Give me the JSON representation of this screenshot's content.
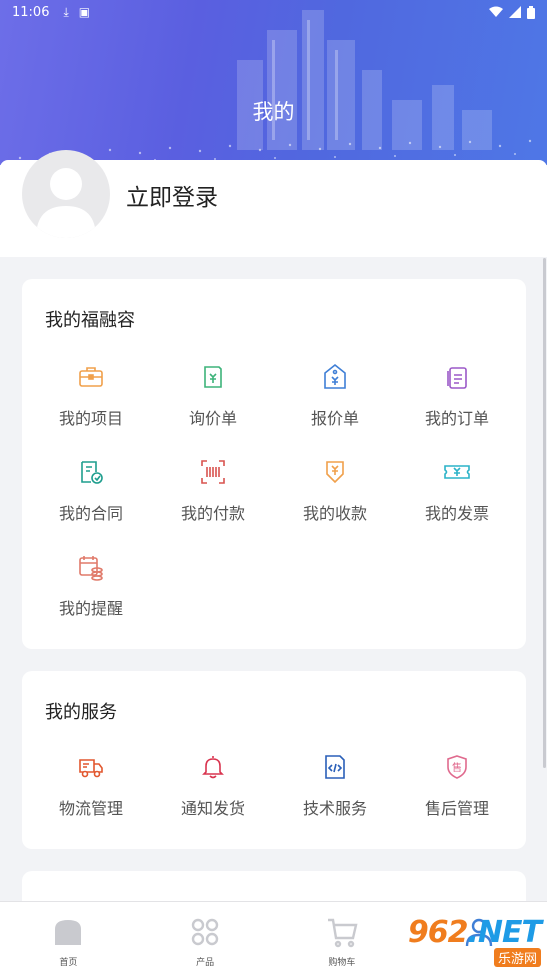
{
  "status_bar": {
    "time": "11:06"
  },
  "header": {
    "title": "我的"
  },
  "profile": {
    "login_label": "立即登录"
  },
  "section_fuzhurong": {
    "title": "我的福融容",
    "items": [
      {
        "label": "我的项目",
        "icon": "briefcase-icon",
        "color": "#f0a04b"
      },
      {
        "label": "询价单",
        "icon": "inquiry-doc-icon",
        "color": "#3db37a"
      },
      {
        "label": "报价单",
        "icon": "price-tag-icon",
        "color": "#3f7fd6"
      },
      {
        "label": "我的订单",
        "icon": "order-doc-icon",
        "color": "#9b59c8"
      },
      {
        "label": "我的合同",
        "icon": "contract-icon",
        "color": "#1f9e8e"
      },
      {
        "label": "我的付款",
        "icon": "barcode-scan-icon",
        "color": "#d9534f"
      },
      {
        "label": "我的收款",
        "icon": "receive-money-icon",
        "color": "#f0a04b"
      },
      {
        "label": "我的发票",
        "icon": "invoice-ticket-icon",
        "color": "#2bb3c8"
      },
      {
        "label": "我的提醒",
        "icon": "reminder-calendar-icon",
        "color": "#e07a6a"
      }
    ]
  },
  "section_services": {
    "title": "我的服务",
    "items": [
      {
        "label": "物流管理",
        "icon": "truck-icon",
        "color": "#e2572e"
      },
      {
        "label": "通知发货",
        "icon": "bell-icon",
        "color": "#d9344f"
      },
      {
        "label": "技术服务",
        "icon": "code-doc-icon",
        "color": "#2a5fb8"
      },
      {
        "label": "售后管理",
        "icon": "after-sales-shield-icon",
        "color": "#e06a8e"
      }
    ]
  },
  "bottom_nav": [
    {
      "label": "首页",
      "icon": "home-icon"
    },
    {
      "label": "产品",
      "icon": "grid-apps-icon"
    },
    {
      "label": "购物车",
      "icon": "cart-icon"
    },
    {
      "label": "",
      "icon": "user-icon"
    }
  ],
  "watermark": {
    "brand": "962",
    "tld": ".NET",
    "sub": "乐游网"
  }
}
